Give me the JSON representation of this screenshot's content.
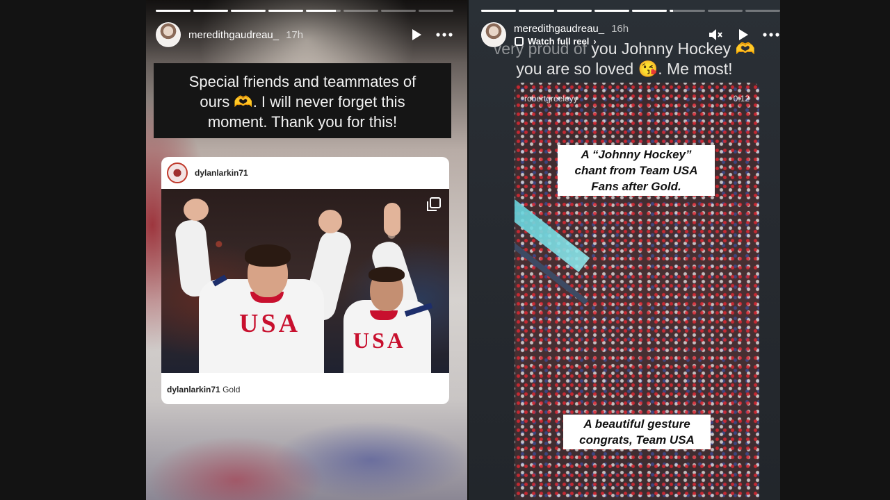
{
  "left_story": {
    "progress": [
      1,
      1,
      1,
      1,
      0.85,
      0,
      0,
      0
    ],
    "username": "meredithgaudreau_",
    "time": "17h",
    "caption_lines": [
      "Special friends and teammates of",
      "ours 🫶. I will never forget this",
      "moment. Thank you for this!"
    ],
    "post": {
      "username": "dylanlarkin71",
      "caption_user": "dylanlarkin71",
      "caption_text": "Gold",
      "jersey_text_1": "USA",
      "jersey_text_2": "USA"
    }
  },
  "right_story": {
    "progress": [
      1,
      1,
      1,
      1,
      1,
      0.1,
      0,
      0
    ],
    "username": "meredithgaudreau_",
    "time": "16h",
    "watch_full_reel": "Watch full reel",
    "caption_line_1_faded": "very proud of",
    "caption_line_1": " you Johnny Hockey 🫶",
    "caption_line_2": "you are so loved 😘. Me most!",
    "reel": {
      "username": "robertgreeleyy",
      "time": "0:12",
      "sticker_top": [
        "A “Johnny Hockey”",
        "chant from Team USA",
        "Fans after Gold."
      ],
      "sticker_bottom": [
        "A beautiful gesture",
        "congrats, Team USA"
      ]
    }
  },
  "icons": [
    "play-icon",
    "more-icon",
    "mute-icon",
    "reel-icon",
    "multi-image-icon"
  ],
  "colors": {
    "background": "#131313",
    "accent_red": "#c8102e",
    "jersey_blue": "#1d2e6b"
  }
}
